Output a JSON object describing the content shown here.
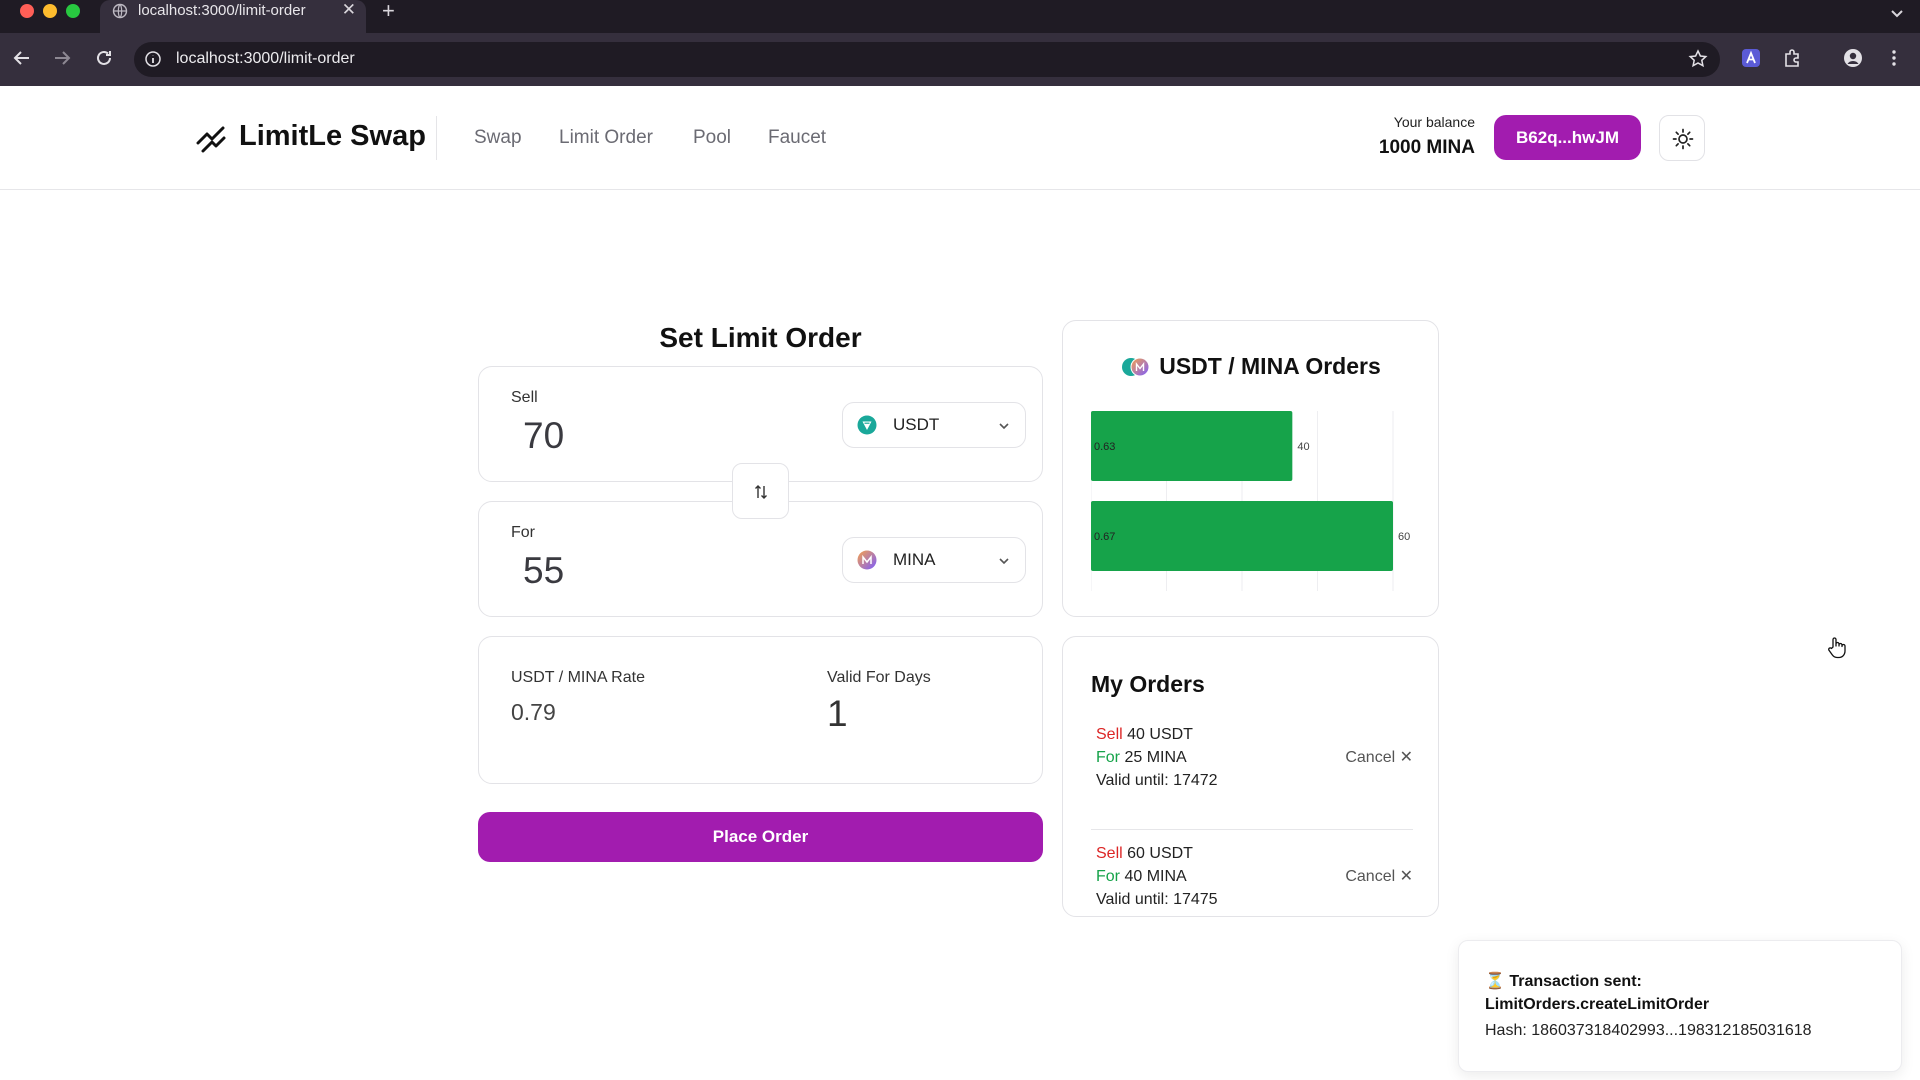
{
  "browser": {
    "tab_title": "localhost:3000/limit-order",
    "tab_close": "✕",
    "new_tab": "+",
    "url": "localhost:3000/limit-order"
  },
  "header": {
    "brand": "LimitLe Swap",
    "nav": [
      "Swap",
      "Limit Order",
      "Pool",
      "Faucet"
    ],
    "balance_label": "Your balance",
    "balance_value": "1000 MINA",
    "wallet_address": "B62q...hwJM"
  },
  "form": {
    "title": "Set Limit Order",
    "sell_label": "Sell",
    "sell_amount": "70",
    "sell_token": "USDT",
    "for_label": "For",
    "for_amount": "55",
    "for_token": "MINA",
    "rate_label": "USDT / MINA Rate",
    "rate_value": "0.79",
    "days_label": "Valid For Days",
    "days_value": "1",
    "submit_label": "Place Order"
  },
  "chart_data": {
    "type": "bar",
    "title": "USDT / MINA Orders",
    "orientation": "horizontal",
    "categories": [
      "0.63",
      "0.67"
    ],
    "values": [
      40,
      60
    ],
    "xlim": [
      0,
      60
    ],
    "bar_color": "#16a34a",
    "grid": true
  },
  "orders": {
    "title": "My Orders",
    "items": [
      {
        "sell_word": "Sell",
        "sell_text": "40 USDT",
        "for_word": "For",
        "for_text": "25 MINA",
        "valid": "Valid until: 17472",
        "cancel": "Cancel ✕"
      },
      {
        "sell_word": "Sell",
        "sell_text": "60 USDT",
        "for_word": "For",
        "for_text": "40 MINA",
        "valid": "Valid until: 17475",
        "cancel": "Cancel ✕"
      }
    ]
  },
  "toast": {
    "line1": "⏳ Transaction sent:",
    "line2": "LimitOrders.createLimitOrder",
    "hash": "Hash: 186037318402993...198312185031618"
  },
  "colors": {
    "accent": "#a21caf",
    "sell": "#dc2626",
    "buy": "#16a34a"
  }
}
